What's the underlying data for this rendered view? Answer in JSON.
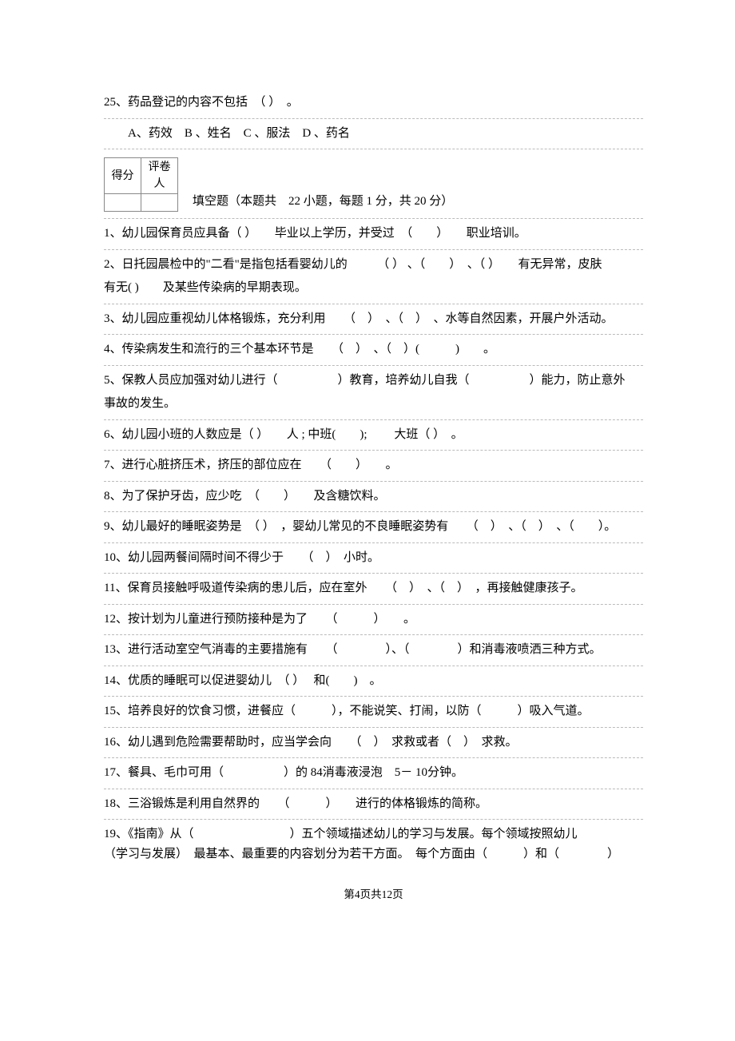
{
  "q25": {
    "text": "25、药品登记的内容不包括　（ ）　。",
    "opts": "A、药效　B 、姓名　C 、服法　D 、药名"
  },
  "scorebox": {
    "h1": "得分",
    "h2": "评卷人",
    "title": "填空题（本题共　22 小题，每题 1 分，共 20 分）"
  },
  "items": [
    "1、幼儿园保育员应具备（ ）　　毕业以上学历，并受过　（　　）　　职业培训。",
    "2、日托园晨检中的\"二看\"是指包括看婴幼儿的　　　（ ） 、（　　）　、（ ）　　有无异常，皮肤",
    "有无( )　　及某些传染病的早期表现。",
    "3、幼儿园应重视幼儿体格锻炼，充分利用　　（　）　、（　）　、水等自然因素，开展户外活动。",
    "4、传染病发生和流行的三个基本环节是　　（　）　、（　）(　　　)　　。",
    "5、保教人员应加强对幼儿进行（　　　　　）教育，培养幼儿自我（　　　　　）能力，防止意外",
    "事故的发生。",
    "6、幼儿园小班的人数应是（ ）　　人 ; 中班(　　); 　　大班（ ）　。",
    "7、进行心脏挤压术，挤压的部位应在　　（　　）　　。",
    "8、为了保护牙齿，应少吃　（　　）　　及含糖饮料。",
    "9、幼儿最好的睡眠姿势是　（ ）　，婴幼儿常见的不良睡眠姿势有　　（　）　、（　）　、（　　）。",
    "10、幼儿园两餐间隔时间不得少于　　（　）　小时。",
    "11、保育员接触呼吸道传染病的患儿后，应在室外　　（　）　、（　）　，再接触健康孩子。",
    "12、按计划为儿童进行预防接种是为了　　（　　　）　　。",
    "13、进行活动室空气消毒的主要措施有　　（　　　　）、（　　　　）和消毒液喷洒三种方式。",
    "14、优质的睡眠可以促进婴幼儿　（ ）　 和(　　)　。",
    "15、培养良好的饮食习惯，进餐应（　　　），不能说笑、打闹，以防（　　　）吸入气道。",
    "16、幼儿遇到危险需要帮助时，应当学会向　　（　）　求救或者（　）　求救。",
    "17、餐具、毛巾可用（　　　　　）的 84消毒液浸泡　5－ 10分钟。",
    "18、三浴锻炼是利用自然界的　　（　　　）　　进行的体格锻炼的简称。",
    "19、《指南》从（　　　　　　　　）五个领域描述幼儿的学习与发展。每个领域按照幼儿",
    "（学习与发展）　最基本、最重要的内容划分为若干方面。　每个方面由（　　　）和（　　　　）"
  ],
  "footer": "第4页共12页"
}
